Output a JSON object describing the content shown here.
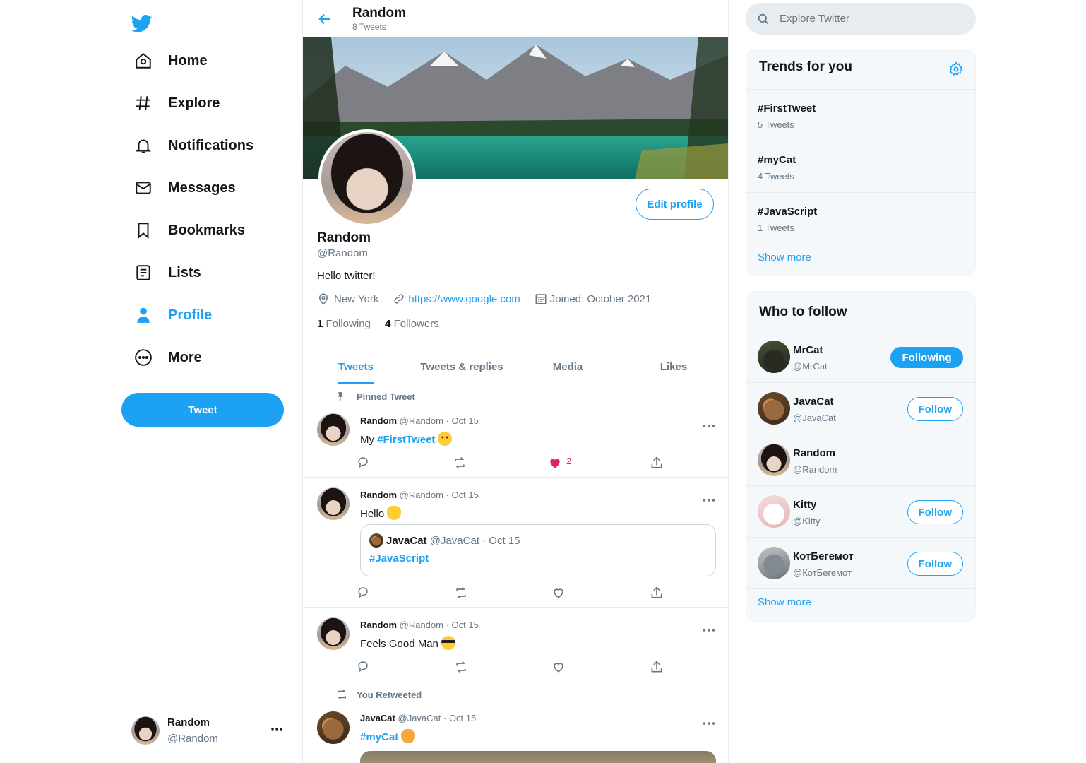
{
  "nav": {
    "items": [
      {
        "label": "Home",
        "icon": "home-icon"
      },
      {
        "label": "Explore",
        "icon": "hashtag-icon"
      },
      {
        "label": "Notifications",
        "icon": "bell-icon"
      },
      {
        "label": "Messages",
        "icon": "envelope-icon"
      },
      {
        "label": "Bookmarks",
        "icon": "bookmark-icon"
      },
      {
        "label": "Lists",
        "icon": "list-icon"
      },
      {
        "label": "Profile",
        "icon": "person-icon",
        "active": true
      },
      {
        "label": "More",
        "icon": "more-circle-icon"
      }
    ],
    "tweet_button": "Tweet",
    "account": {
      "name": "Random",
      "handle": "@Random"
    }
  },
  "header": {
    "title": "Random",
    "subtitle": "8 Tweets"
  },
  "profile": {
    "name": "Random",
    "handle": "@Random",
    "bio": "Hello twitter!",
    "location": "New York",
    "website": "https://www.google.com",
    "joined": "Joined: October 2021",
    "following_count": "1",
    "following_label": "Following",
    "followers_count": "4",
    "followers_label": "Followers",
    "edit_button": "Edit profile"
  },
  "tabs": [
    "Tweets",
    "Tweets & replies",
    "Media",
    "Likes"
  ],
  "tweets": [
    {
      "context": "Pinned Tweet",
      "name": "Random",
      "meta": "@Random · Oct 15",
      "text_prefix": "My ",
      "hashtag": "#FirstTweet",
      "emoji": "slightly-smiling-face",
      "likes": "2"
    },
    {
      "name": "Random",
      "meta": "@Random · Oct 15",
      "text": "Hello",
      "emoji": "waving-hand",
      "quote": {
        "name": "JavaCat",
        "meta": "@JavaCat · Oct 15",
        "hashtag": "#JavaScript"
      }
    },
    {
      "name": "Random",
      "meta": "@Random · Oct 15",
      "text": "Feels Good Man",
      "emoji": "sunglasses-face"
    },
    {
      "context": "You Retweeted",
      "name": "JavaCat",
      "meta": "@JavaCat · Oct 15",
      "hashtag": "#myCat",
      "emoji": "kissing-cat-face"
    }
  ],
  "search": {
    "placeholder": "Explore Twitter"
  },
  "trends": {
    "title": "Trends for you",
    "items": [
      {
        "tag": "#FirstTweet",
        "count": "5 Tweets"
      },
      {
        "tag": "#myCat",
        "count": "4 Tweets"
      },
      {
        "tag": "#JavaScript",
        "count": "1 Tweets"
      }
    ],
    "show_more": "Show more"
  },
  "who_to_follow": {
    "title": "Who to follow",
    "users": [
      {
        "name": "MrCat",
        "handle": "@MrCat",
        "button": "Following"
      },
      {
        "name": "JavaCat",
        "handle": "@JavaCat",
        "button": "Follow"
      },
      {
        "name": "Random",
        "handle": "@Random",
        "button": ""
      },
      {
        "name": "Kitty",
        "handle": "@Kitty",
        "button": "Follow"
      },
      {
        "name": "КотБегемот",
        "handle": "@КотБегемот",
        "button": "Follow"
      }
    ],
    "show_more": "Show more"
  },
  "colors": {
    "accent": "#1da1f2",
    "like": "#e0245e",
    "text": "#14171a",
    "muted": "#657786"
  }
}
